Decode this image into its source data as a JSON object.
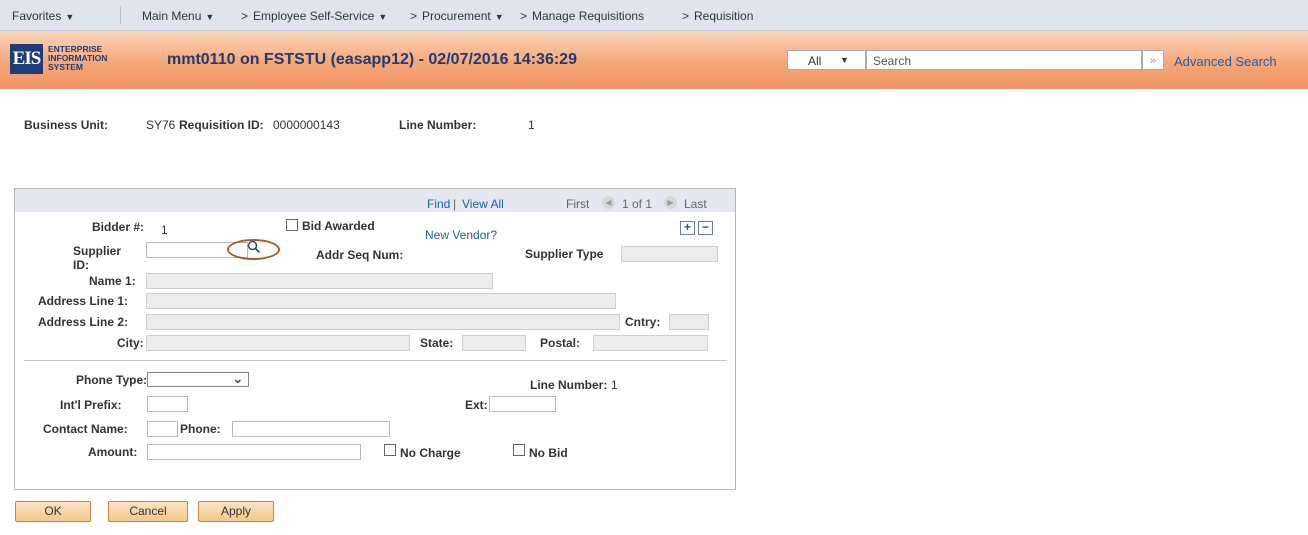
{
  "nav": {
    "favorites": "Favorites",
    "main_menu": "Main Menu",
    "sep": ">",
    "employee_self_service": "Employee Self-Service",
    "procurement": "Procurement",
    "manage_requisitions": "Manage Requisitions",
    "requisition": "Requisition"
  },
  "header": {
    "logo_mark": "EIS",
    "logo_line1": "ENTERPRISE",
    "logo_line2": "INFORMATION",
    "logo_line3": "SYSTEM",
    "title": "mmt0110 on FSTSTU (easapp12) - 02/07/2016 14:36:29",
    "search_scope": "All",
    "search_placeholder": "Search",
    "search_go": "»",
    "advanced_search": "Advanced Search"
  },
  "info": {
    "business_unit_label": "Business Unit:",
    "business_unit_value": "SY76",
    "requisition_id_label": "Requisition ID:",
    "requisition_id_value": "0000000143",
    "line_number_label": "Line Number:",
    "line_number_value": "1"
  },
  "grid": {
    "find": "Find",
    "separator": "|",
    "view_all": "View All",
    "first": "First",
    "count": "1 of 1",
    "last": "Last"
  },
  "form": {
    "bidder_label": "Bidder #:",
    "bidder_value": "1",
    "bid_awarded": "Bid Awarded",
    "new_vendor": "New Vendor?",
    "supplier_id_label": "Supplier",
    "supplier_id_label2": "ID:",
    "addr_seq_label": "Addr Seq Num:",
    "supplier_type_label": "Supplier Type",
    "name1_label": "Name 1:",
    "addr1_label": "Address Line 1:",
    "addr2_label": "Address Line 2:",
    "cntry_label": "Cntry:",
    "city_label": "City:",
    "state_label": "State:",
    "postal_label": "Postal:",
    "phone_type_label": "Phone Type:",
    "line_number_label": "Line Number:",
    "line_number_value": "1",
    "intl_prefix_label": "Int'l Prefix:",
    "ext_label": "Ext:",
    "contact_name_label": "Contact Name:",
    "phone_label": "Phone:",
    "amount_label": "Amount:",
    "no_charge": "No Charge",
    "no_bid": "No Bid"
  },
  "buttons": {
    "ok": "OK",
    "cancel": "Cancel",
    "apply": "Apply"
  }
}
